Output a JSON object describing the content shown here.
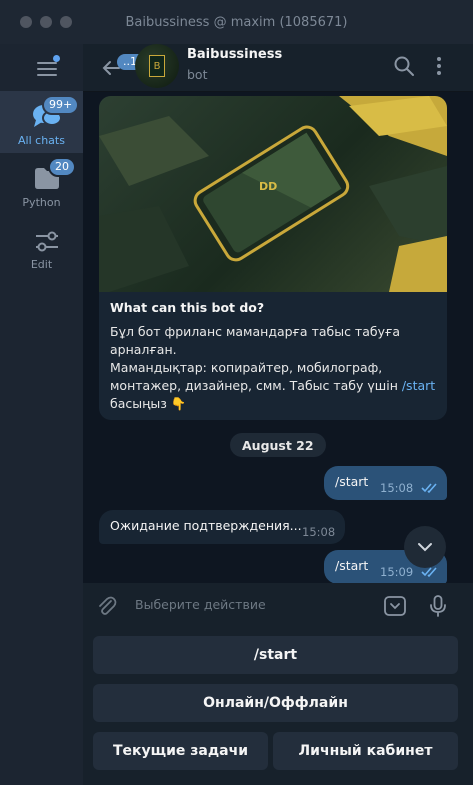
{
  "window": {
    "title": "Baibussiness @ maxim (1085671)"
  },
  "sidebar": {
    "folders": [
      {
        "label": "All chats",
        "badge": "99+"
      },
      {
        "label": "Python",
        "badge": "20"
      },
      {
        "label": "Edit",
        "badge": ""
      }
    ]
  },
  "header": {
    "back_badge": "..12",
    "chat_name": "Baibussiness",
    "chat_status": "bot",
    "avatar_letter": "B"
  },
  "bot_card": {
    "image_logo_text": "DD",
    "title": "What can this bot do?",
    "text_before": "Бұл бот фриланс мамандарға табыс табуға арналған.\nМамандықтар: копирайтер, мобилограф, монтажер, дизайнер, смм. Табыс табу үшін ",
    "command": "/start",
    "text_after": "\nбасыңыз 👇"
  },
  "date_separator": "August 22",
  "messages": [
    {
      "direction": "out",
      "text": "/start",
      "time": "15:08"
    },
    {
      "direction": "in",
      "text": "Ожидание подтверждения...",
      "time": "15:08"
    },
    {
      "direction": "out",
      "text": "/start",
      "time": "15:09"
    }
  ],
  "composer": {
    "placeholder": "Выберите действие"
  },
  "keyboard": {
    "row1": [
      "/start"
    ],
    "row2": [
      "Онлайн/Оффлайн"
    ],
    "row3": [
      "Текущие задачи",
      "Личный кабинет"
    ]
  },
  "colors": {
    "accent": "#5288c1",
    "link": "#6ab2f2",
    "outgoing_bubble": "#2b5278",
    "incoming_bubble": "#182533"
  }
}
